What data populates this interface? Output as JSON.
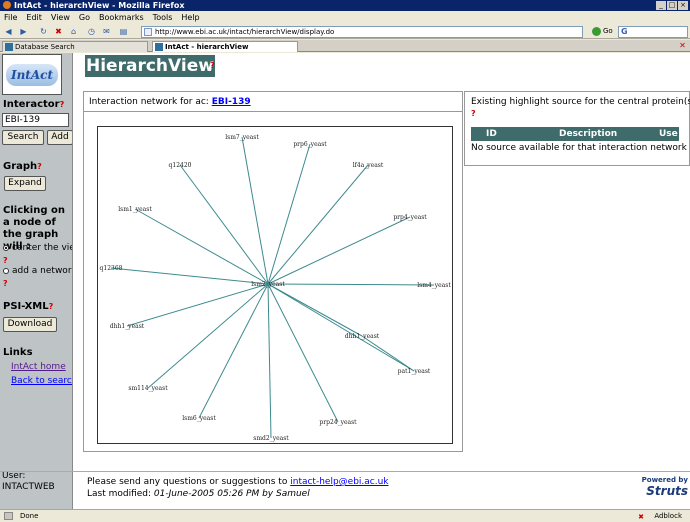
{
  "window": {
    "title": "IntAct - hierarchView - Mozilla Firefox"
  },
  "menu": [
    "File",
    "Edit",
    "View",
    "Go",
    "Bookmarks",
    "Tools",
    "Help"
  ],
  "nav": {
    "url": "http://www.ebi.ac.uk/intact/hierarchView/display.do",
    "go_label": "Go",
    "search_value": "G"
  },
  "tabs": [
    {
      "label": "Database Search",
      "active": false
    },
    {
      "label": "IntAct - hierarchView",
      "active": true
    }
  ],
  "sidebar": {
    "logo_text": "IntAct",
    "interactor_heading": "Interactor",
    "interactor_value": "EBI-139",
    "search_button": "Search",
    "add_button": "Add",
    "graph_heading": "Graph",
    "expand_button": "Expand",
    "clicking_heading": "Clicking on a node of the graph will :",
    "radio_center": "center the view",
    "radio_add": "add a network",
    "psixml_heading": "PSI-XML",
    "download_button": "Download",
    "links_heading": "Links",
    "link_intact_home": "IntAct home",
    "link_back": "Back to search",
    "user_label": "User:",
    "user_name": "INTACTWEB"
  },
  "help_mark": "?",
  "page": {
    "title": "HierarchView",
    "network_header_prefix": "Interaction network for ac:",
    "network_ac": "EBI-139",
    "highlight_text": "Existing highlight source for the central protein(s).",
    "table_headers": [
      "ID",
      "Description",
      "Use"
    ],
    "no_source": "No source available for that interaction network"
  },
  "graph": {
    "center": "lsm2_yeast",
    "nodes": [
      "lsm7_yeast",
      "prp6_yeast",
      "lf4a_yeast",
      "prp4_yeast",
      "lsm4_yeast",
      "dhh1_yeast",
      "pat1_yeast",
      "prp24_yeast",
      "smd2_yeast",
      "lsm6_yeast",
      "sm114_yeast",
      "dhh1_yeast",
      "q12368",
      "lsm1_yeast",
      "q12420"
    ],
    "edge_color": "#3d8a8e"
  },
  "footer": {
    "contact_prefix": "Please send any questions or suggestions to",
    "contact_email": "intact-help@ebi.ac.uk",
    "modified_prefix": "Last modified:",
    "modified_value": "01-June-2005 05:26 PM by Samuel",
    "powered": "Powered by",
    "struts": "Struts"
  },
  "status": {
    "text": "Done",
    "adblock": "Adblock"
  }
}
